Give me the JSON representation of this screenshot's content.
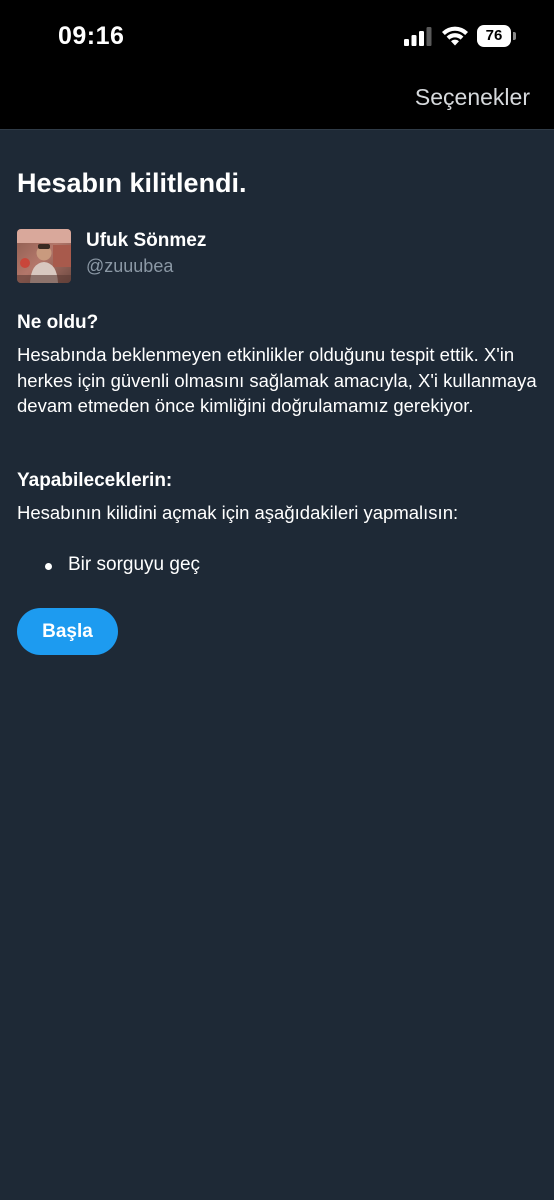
{
  "status_bar": {
    "time": "09:16",
    "battery_level": "76",
    "icons": [
      "signal-icon",
      "wifi-icon",
      "battery-icon"
    ]
  },
  "nav": {
    "options_label": "Seçenekler"
  },
  "page": {
    "title": "Hesabın kilitlendi."
  },
  "user": {
    "name": "Ufuk Sönmez",
    "handle": "@zuuubea"
  },
  "what_happened": {
    "heading": "Ne oldu?",
    "text": "Hesabında beklenmeyen etkinlikler olduğunu tespit ettik. X'in herkes için güvenli olmasını sağlamak amacıyla, X'i kullanmaya devam etmeden önce kimliğini doğrulamamız gerekiyor."
  },
  "what_you_can_do": {
    "heading": "Yapabileceklerin:",
    "text": "Hesabının kilidini açmak için aşağıdakileri yapmalısın:",
    "items": [
      "Bir sorguyu geç"
    ]
  },
  "actions": {
    "start_label": "Başla"
  },
  "colors": {
    "background": "#1e2936",
    "status_bar": "#000000",
    "accent": "#1d9bf0",
    "secondary_text": "#8b98a5"
  }
}
